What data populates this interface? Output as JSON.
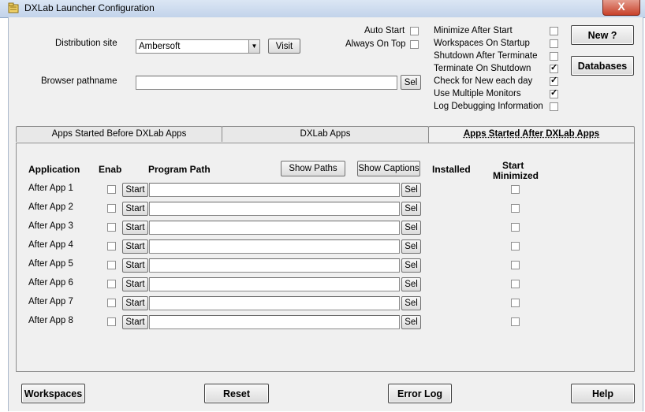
{
  "window": {
    "title": "DXLab Launcher Configuration",
    "close_label": "X"
  },
  "distribution": {
    "label": "Distribution site",
    "value": "Ambersoft",
    "visit_label": "Visit"
  },
  "browser": {
    "label": "Browser pathname",
    "value": "",
    "sel_label": "Sel"
  },
  "auto_start": {
    "label": "Auto Start",
    "checked": false
  },
  "always_on_top": {
    "label": "Always On Top",
    "checked": false
  },
  "options": [
    {
      "label": "Minimize After Start",
      "checked": false
    },
    {
      "label": "Workspaces On Startup",
      "checked": false
    },
    {
      "label": "Shutdown After Terminate",
      "checked": false
    },
    {
      "label": "Terminate On Shutdown",
      "checked": true
    },
    {
      "label": "Check for New each day",
      "checked": true
    },
    {
      "label": "Use Multiple Monitors",
      "checked": true
    },
    {
      "label": "Log Debugging Information",
      "checked": false
    }
  ],
  "buttons": {
    "new": "New ?",
    "databases": "Databases",
    "workspaces": "Workspaces",
    "reset": "Reset",
    "error_log": "Error Log",
    "help": "Help",
    "show_paths": "Show Paths",
    "show_captions": "Show Captions"
  },
  "tabs": [
    {
      "label": "Apps Started Before DXLab Apps",
      "active": false
    },
    {
      "label": "DXLab Apps",
      "active": false
    },
    {
      "label": "Apps Started After DXLab Apps",
      "active": true
    }
  ],
  "table": {
    "headers": {
      "application": "Application",
      "enab": "Enab",
      "program_path": "Program Path",
      "installed": "Installed",
      "start_minimized_1": "Start",
      "start_minimized_2": "Minimized"
    },
    "start_label": "Start",
    "sel_label": "Sel",
    "rows": [
      {
        "name": "After App 1",
        "enabled": false,
        "path": "",
        "minimized": false
      },
      {
        "name": "After App 2",
        "enabled": false,
        "path": "",
        "minimized": false
      },
      {
        "name": "After App 3",
        "enabled": false,
        "path": "",
        "minimized": false
      },
      {
        "name": "After App 4",
        "enabled": false,
        "path": "",
        "minimized": false
      },
      {
        "name": "After App 5",
        "enabled": false,
        "path": "",
        "minimized": false
      },
      {
        "name": "After App 6",
        "enabled": false,
        "path": "",
        "minimized": false
      },
      {
        "name": "After App 7",
        "enabled": false,
        "path": "",
        "minimized": false
      },
      {
        "name": "After App 8",
        "enabled": false,
        "path": "",
        "minimized": false
      }
    ]
  }
}
